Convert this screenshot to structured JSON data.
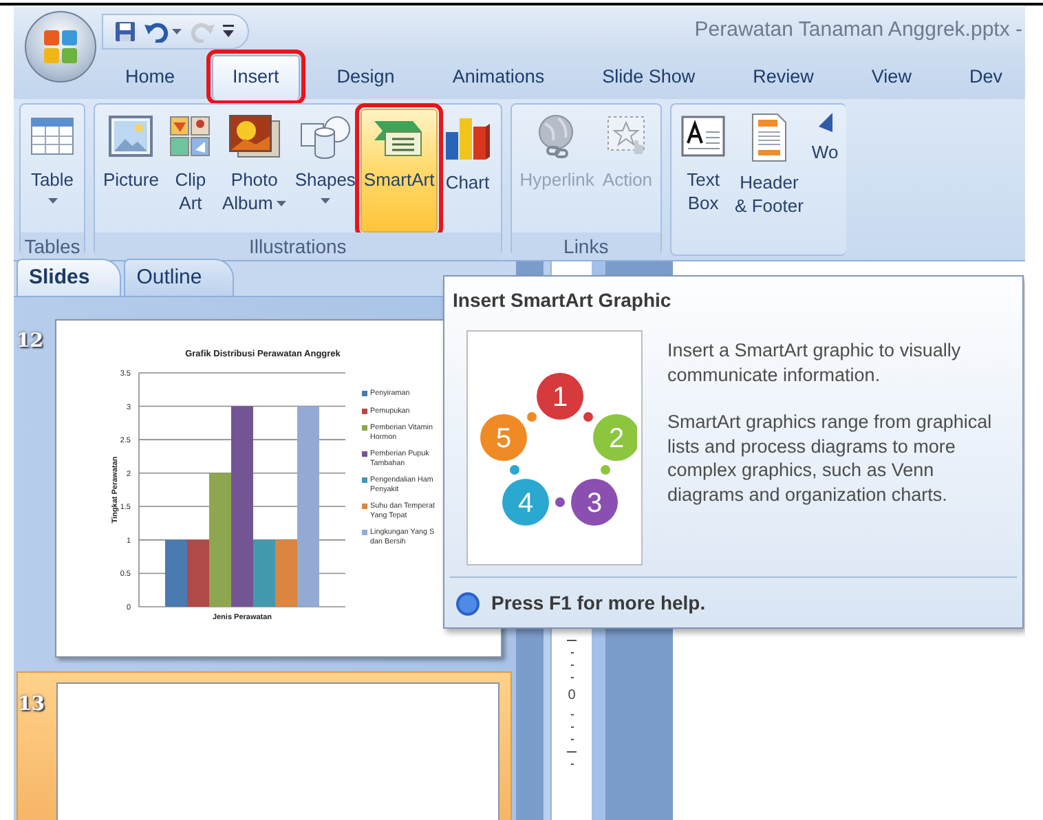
{
  "window": {
    "title": "Perawatan Tanaman Anggrek.pptx -"
  },
  "quick_access": [
    {
      "kind": "save",
      "disabled": false,
      "dropdown": false
    },
    {
      "kind": "undo",
      "disabled": false,
      "dropdown": true
    },
    {
      "kind": "redo",
      "disabled": true,
      "dropdown": false
    },
    {
      "kind": "customize",
      "disabled": false,
      "dropdown": false
    }
  ],
  "tabs": [
    {
      "label": "Home",
      "selected": false,
      "marked": false
    },
    {
      "label": "Insert",
      "selected": true,
      "marked": true
    },
    {
      "label": "Design",
      "selected": false,
      "marked": false
    },
    {
      "label": "Animations",
      "selected": false,
      "marked": false
    },
    {
      "label": "Slide Show",
      "selected": false,
      "marked": false
    },
    {
      "label": "Review",
      "selected": false,
      "marked": false
    },
    {
      "label": "View",
      "selected": false,
      "marked": false
    },
    {
      "label": "Dev",
      "selected": false,
      "marked": false
    }
  ],
  "ribbon": {
    "groups": [
      {
        "label": "Tables",
        "buttons": [
          {
            "kind": "table",
            "label": [
              "Table"
            ],
            "dropdown": true,
            "disabled": false,
            "hover": false,
            "marked": false
          }
        ]
      },
      {
        "label": "Illustrations",
        "buttons": [
          {
            "kind": "picture",
            "label": [
              "Picture"
            ],
            "dropdown": false,
            "disabled": false,
            "hover": false,
            "marked": false
          },
          {
            "kind": "clipart",
            "label": [
              "Clip",
              "Art"
            ],
            "dropdown": false,
            "disabled": false,
            "hover": false,
            "marked": false
          },
          {
            "kind": "photo",
            "label": [
              "Photo",
              "Album"
            ],
            "dropdown": true,
            "disabled": false,
            "hover": false,
            "marked": false
          },
          {
            "kind": "shapes",
            "label": [
              "Shapes"
            ],
            "dropdown": true,
            "disabled": false,
            "hover": false,
            "marked": false
          },
          {
            "kind": "smartart",
            "label": [
              "SmartArt"
            ],
            "dropdown": false,
            "disabled": false,
            "hover": true,
            "marked": true
          },
          {
            "kind": "chart",
            "label": [
              "Chart"
            ],
            "dropdown": false,
            "disabled": false,
            "hover": false,
            "marked": false
          }
        ]
      },
      {
        "label": "Links",
        "buttons": [
          {
            "kind": "hyperlink",
            "label": [
              "Hyperlink"
            ],
            "dropdown": false,
            "disabled": true,
            "hover": false,
            "marked": false
          },
          {
            "kind": "action",
            "label": [
              "Action"
            ],
            "dropdown": false,
            "disabled": true,
            "hover": false,
            "marked": false
          }
        ]
      },
      {
        "buttons": [
          {
            "kind": "textbox",
            "label": [
              "Text",
              "Box"
            ],
            "dropdown": false,
            "disabled": false,
            "hover": false,
            "marked": false
          },
          {
            "kind": "header",
            "label": [
              "Header",
              "& Footer"
            ],
            "dropdown": false,
            "disabled": false,
            "hover": false,
            "marked": false
          },
          {
            "kind": "wordart",
            "label": [
              "Wo"
            ],
            "dropdown": false,
            "disabled": false,
            "hover": false,
            "marked": false
          }
        ]
      }
    ]
  },
  "slides_pane": {
    "tabs": [
      {
        "label": "Slides",
        "selected": true
      },
      {
        "label": "Outline",
        "selected": false
      }
    ],
    "slides": [
      {
        "number": "12",
        "selected": false,
        "chart_data": {
          "type": "bar",
          "grid": true,
          "legend": "right",
          "title": "Grafik Distribusi Perawatan Anggrek",
          "ylabel": "Tingkat Perawatan",
          "categories": [
            "Jenis Perawatan"
          ],
          "ylim": [
            0,
            3.5
          ],
          "yticks": [
            0,
            0.5,
            1,
            1.5,
            2,
            2.5,
            3,
            3.5
          ],
          "series": [
            {
              "name": "Penyiraman",
              "color": "#4a7ab0",
              "values": [
                1
              ]
            },
            {
              "name": "Pemupukan",
              "color": "#b04a48",
              "values": [
                1
              ]
            },
            {
              "name": "Pemberian Vitamin Hormon",
              "color": "#8ea650",
              "values": [
                2
              ]
            },
            {
              "name": "Pemberian Pupuk Tambahan",
              "color": "#735594",
              "values": [
                3
              ]
            },
            {
              "name": "Pengendalian Ham Penyakit",
              "color": "#4399ae",
              "values": [
                1
              ]
            },
            {
              "name": "Suhu dan Temperat Yang Tepat",
              "color": "#db8540",
              "values": [
                1
              ]
            },
            {
              "name": "Lingkungan Yang S dan Bersih",
              "color": "#94aad3",
              "values": [
                3
              ]
            }
          ]
        }
      },
      {
        "number": "13",
        "selected": true
      }
    ]
  },
  "ruler": {
    "label": "0"
  },
  "tooltip": {
    "title": "Insert SmartArt Graphic",
    "diagram": [
      {
        "number": "1",
        "color": "#d63a3c"
      },
      {
        "number": "2",
        "color": "#8cc63f"
      },
      {
        "number": "3",
        "color": "#8a4fb0"
      },
      {
        "number": "4",
        "color": "#2aa8d0"
      },
      {
        "number": "5",
        "color": "#f08a24"
      }
    ],
    "paragraphs": [
      "Insert a SmartArt graphic to visually communicate information.",
      "SmartArt graphics range from graphical lists and process diagrams to more complex graphics, such as Venn diagrams and organization charts."
    ],
    "help": "Press F1 for more help."
  }
}
